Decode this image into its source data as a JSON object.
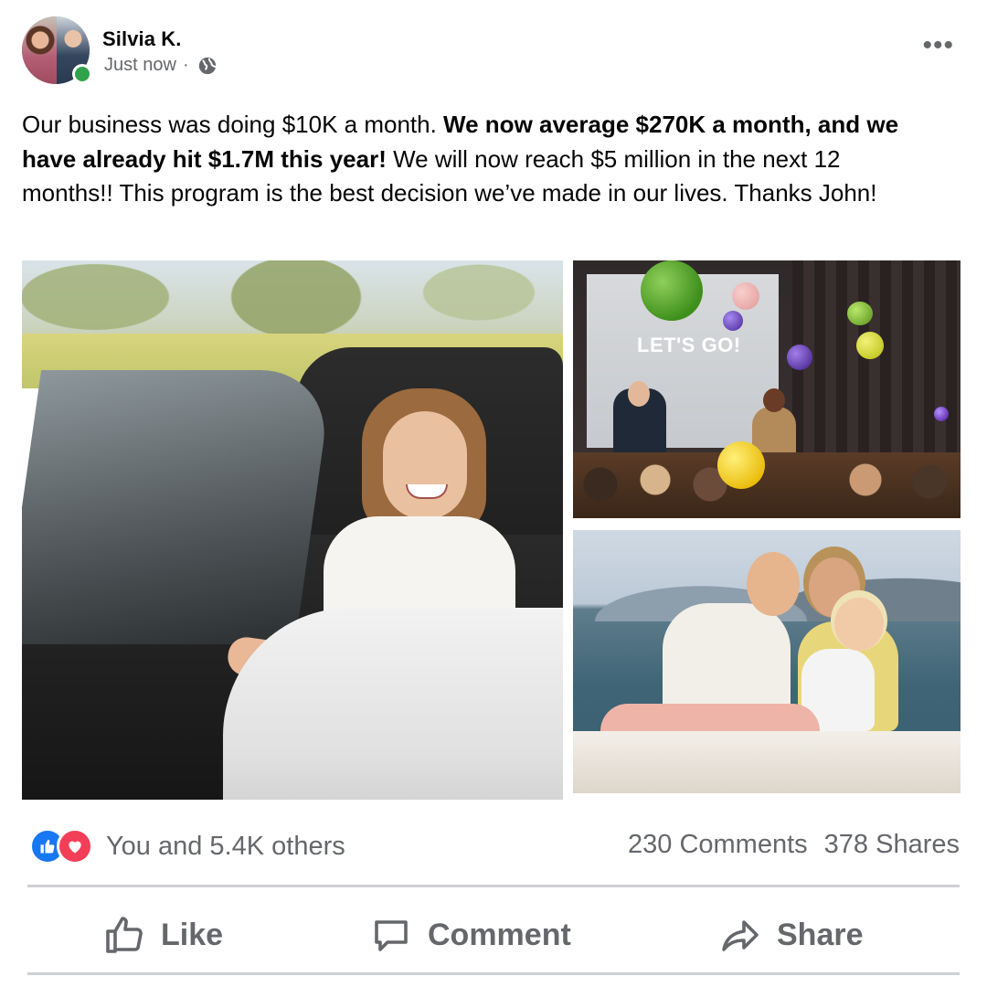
{
  "header": {
    "author": "Silvia K.",
    "timestamp": "Just now",
    "separator": "·",
    "privacy_icon": "globe-icon",
    "more_icon": "more-options-icon",
    "more_glyph": "•••",
    "online_color": "#31a24c"
  },
  "post": {
    "text_part1": "Our business was doing $10K a month. ",
    "text_bold": "We now average $270K a month, and we have already hit $1.7M this year!",
    "text_part2": " We will now reach $5 million in the next 12 months!! This program is the best decision we’ve made in our lives. Thanks John!"
  },
  "photos": {
    "event_screen_text": "LET'S GO!"
  },
  "stats": {
    "reactions_text": "You and 5.4K others",
    "comments": "230 Comments",
    "shares": "378 Shares",
    "like_color": "#1877f2",
    "love_color": "#f33e58"
  },
  "actions": {
    "like": "Like",
    "comment": "Comment",
    "share": "Share"
  }
}
